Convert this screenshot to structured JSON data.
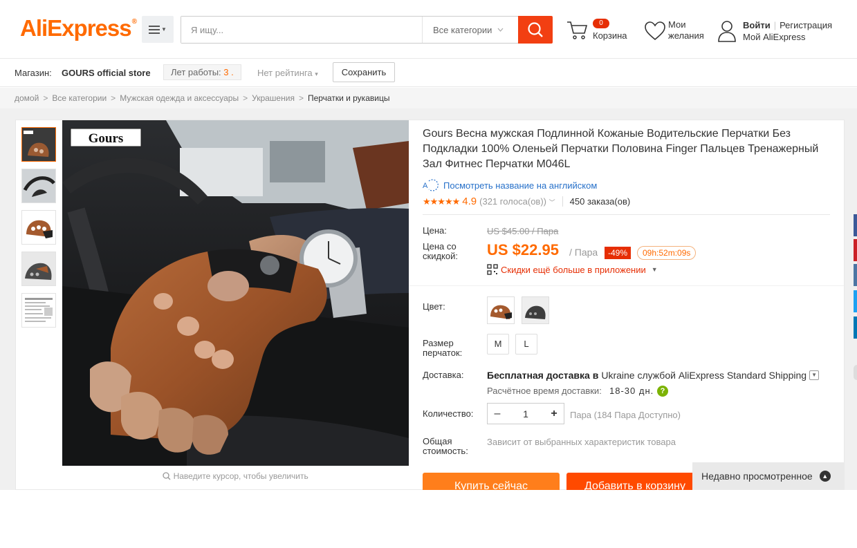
{
  "header": {
    "logo": "AliExpress",
    "search_placeholder": "Я ищу...",
    "category_select": "Все категории",
    "cart_count": "0",
    "cart_label": "Корзина",
    "wishlist_line1": "Мои",
    "wishlist_line2": "желания",
    "login": "Войти",
    "register": "Регистрация",
    "my_account": "Мой AliExpress"
  },
  "store": {
    "label": "Магазин:",
    "name": "GOURS official store",
    "years_label": "Лет работы:",
    "years_value": "3 .",
    "rating": "Нет рейтинга",
    "save": "Сохранить"
  },
  "breadcrumb": [
    "домой",
    "Все категории",
    "Мужская одежда и аксессуары",
    "Украшения",
    "Перчатки и рукавицы"
  ],
  "gallery": {
    "brand_text": "Gours",
    "zoom_hint": "Наведите курсор, чтобы увеличить"
  },
  "product": {
    "title": "Gours Весна мужская Подлинной Кожаные Водительские Перчатки Без Подкладки 100% Оленьей Перчатки Половина Finger Пальцев Тренажерный Зал Фитнес Перчатки M046L",
    "translate_link": "Посмотреть название на английском",
    "rating_value": "4.9",
    "rating_fraction": 0.98,
    "votes": "(321 голоса(ов))",
    "orders": "450 заказа(ов)",
    "price_label": "Цена:",
    "old_price": "US $45.00 / Пара",
    "discount_label": "Цена со скидкой:",
    "new_price": "US $22.95",
    "per_unit": "/ Пара",
    "discount_badge": "-49%",
    "timer": "09h:52m:09s",
    "app_promo": "Скидки ещё больше в приложении",
    "color_label": "Цвет:",
    "size_label": "Размер перчаток:",
    "sizes": [
      "M",
      "L"
    ],
    "shipping_label": "Доставка:",
    "shipping_bold": "Бесплатная доставка в",
    "shipping_rest": "Ukraine службой AliExpress Standard Shipping",
    "ship_time_label": "Расчётное время доставки:",
    "ship_time": "18-30 дн.",
    "qty_label": "Количество:",
    "qty_value": "1",
    "qty_note": "Пара (184 Пара Доступно)",
    "total_label": "Общая стоимость:",
    "total_value": "Зависит от выбранных характеристик товара",
    "buy_now": "Купить сейчас",
    "add_to_cart": "Добавить в корзину"
  },
  "recently_viewed": "Недавно просмотренное",
  "colors": {
    "accent": "#ff6a00",
    "search_button": "#f23f12",
    "discount_red": "#e62e04",
    "link_blue": "#2670c9"
  }
}
